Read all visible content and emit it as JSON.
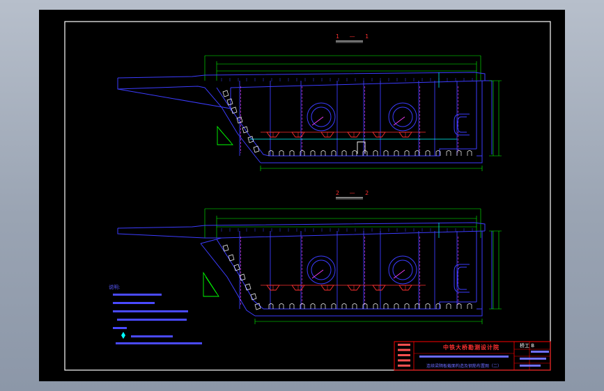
{
  "viewer": {
    "background_color": "#a5aebc",
    "canvas_color": "#000000"
  },
  "drawing": {
    "colors": {
      "frame": "#ffffff",
      "structure": "#3c3cff",
      "dimension": "#00ff00",
      "reinforcement": "#ff3030",
      "cyan_lines": "#00ffff",
      "magenta_lines": "#ff40ff",
      "title_block": "#ff0000"
    },
    "section_1": {
      "label": "1 — 1"
    },
    "section_2": {
      "label": "2 — 2"
    },
    "notes": {
      "heading": "说明:"
    },
    "title_block": {
      "company": "中铁大桥勘测设计院",
      "sheet_title": "连续梁隔板截面构造及钢筋布置图（二）",
      "code": "桥工 B"
    }
  }
}
